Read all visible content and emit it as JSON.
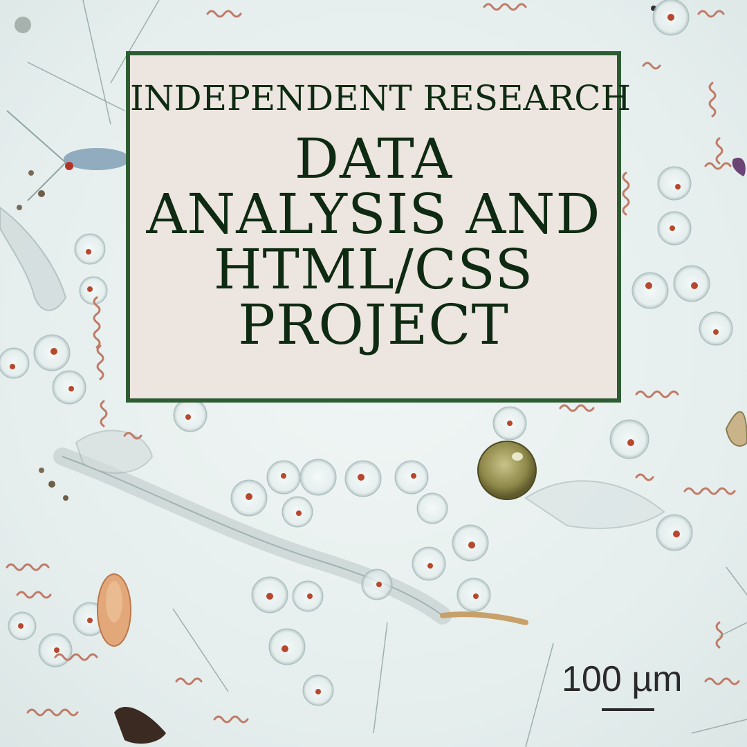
{
  "card": {
    "subtitle": "INDEPENDENT RESEARCH",
    "title_lines": [
      "DATA",
      "ANALYSIS AND",
      "HTML/CSS",
      "PROJECT"
    ]
  },
  "scale_bar": {
    "label": "100 µm"
  },
  "colors": {
    "card_background": "#ede5e0",
    "card_border": "#2d5c33",
    "title_text": "#0e2a12",
    "photo_background": "#e9f0ef"
  },
  "background_image": "plankton-micrograph"
}
